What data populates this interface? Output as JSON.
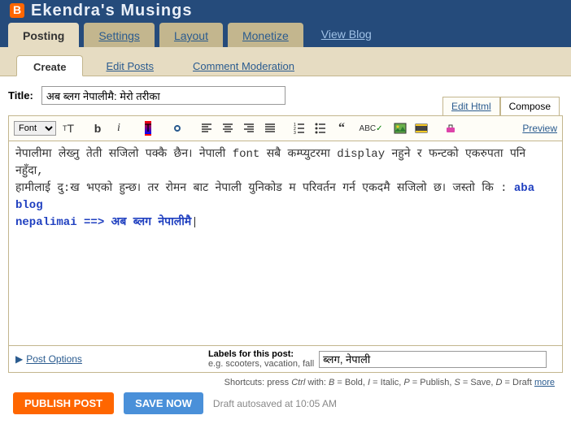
{
  "blog_title": "Ekendra's Musings",
  "main_tabs": {
    "posting": "Posting",
    "settings": "Settings",
    "layout": "Layout",
    "monetize": "Monetize",
    "view_blog": "View Blog"
  },
  "sub_tabs": {
    "create": "Create",
    "edit_posts": "Edit Posts",
    "comment_mod": "Comment Moderation"
  },
  "title": {
    "label": "Title:",
    "value": "अब ब्लग नेपालीमै: मेरो तरीका"
  },
  "mode": {
    "edit_html": "Edit Html",
    "compose": "Compose"
  },
  "toolbar": {
    "font_label": "Font",
    "preview": "Preview"
  },
  "editor": {
    "line1": "नेपालीमा लेख्नु तेती सजिलो पक्कै छैन। नेपाली font सबै कम्प्युटरमा display  नहुने र फन्टको एकरुपता पनि नहुँदा,",
    "line2a": "हामीलाई दु:ख भएको हुन्छ। तर रोमन बाट नेपाली युनिकोड म परिवर्तन गर्न एकदमै सजिलो छ। जस्तो कि : ",
    "line2b": "aba blog",
    "line3a": "nepalimai ==> ",
    "line3b": "अब ब्लग नेपालीमै"
  },
  "footer": {
    "post_options": "Post Options",
    "labels_title": "Labels for this post:",
    "labels_hint": "e.g. scooters, vacation, fall",
    "labels_value": "ब्लग, नेपाली",
    "shortcuts_prefix": "Shortcuts: press ",
    "shortcuts_ctrl": "Ctrl",
    "shortcuts_with": " with: ",
    "sc_b": "B",
    "sc_b_t": " = Bold, ",
    "sc_i": "I",
    "sc_i_t": " = Italic, ",
    "sc_p": "P",
    "sc_p_t": " = Publish, ",
    "sc_s": "S",
    "sc_s_t": " = Save, ",
    "sc_d": "D",
    "sc_d_t": " = Draft ",
    "more": "more"
  },
  "buttons": {
    "publish": "PUBLISH POST",
    "save": "SAVE NOW",
    "draft_status": "Draft autosaved at 10:05 AM"
  }
}
